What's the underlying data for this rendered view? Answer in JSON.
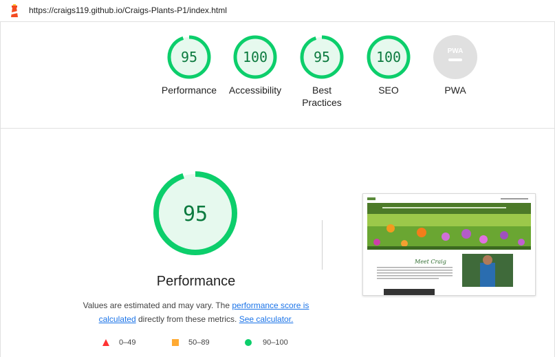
{
  "header": {
    "url": "https://craigs119.github.io/Craigs-Plants-P1/index.html"
  },
  "categories": [
    {
      "label": "Performance",
      "score": "95",
      "score_fraction": 0.95
    },
    {
      "label": "Accessibility",
      "score": "100",
      "score_fraction": 1.0
    },
    {
      "label": "Best Practices",
      "score": "95",
      "score_fraction": 0.95
    },
    {
      "label": "SEO",
      "score": "100",
      "score_fraction": 1.0
    },
    {
      "label": "PWA",
      "badge": "PWA"
    }
  ],
  "performance": {
    "score": "95",
    "score_fraction": 0.95,
    "title": "Performance",
    "desc_prefix": "Values are estimated and may vary. The ",
    "link1": "performance score is calculated",
    "desc_middle": " directly from these metrics. ",
    "link2": "See calculator."
  },
  "legend": [
    {
      "range": "0–49",
      "color": "#ff3333"
    },
    {
      "range": "50–89",
      "color": "#ffaa33"
    },
    {
      "range": "90–100",
      "color": "#0cce6b"
    }
  ],
  "screenshot": {
    "hero_title": "Meet Craig"
  },
  "colors": {
    "pass": "#0cce6b",
    "pass_fill": "#e6f9ee",
    "pass_text": "#0c7a3f",
    "pwa_gray": "#e0e0e0",
    "link": "#1a73e8"
  }
}
